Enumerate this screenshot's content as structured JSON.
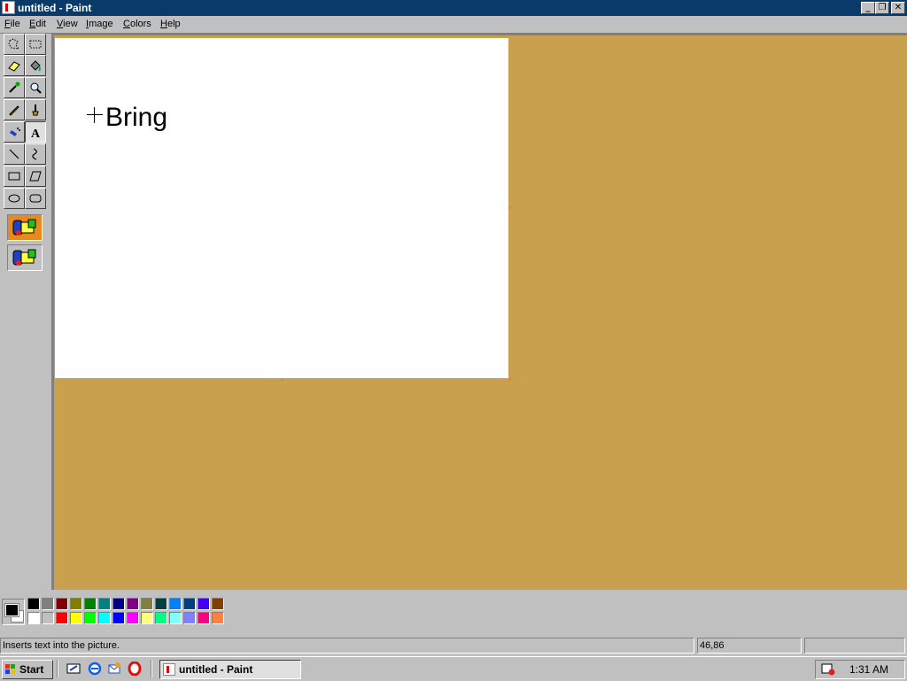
{
  "window": {
    "title": "untitled - Paint",
    "controls": {
      "minimize": "_",
      "restore": "❐",
      "close": "✕"
    }
  },
  "menu": [
    {
      "label": "File",
      "hotkey": "F",
      "rest": "ile"
    },
    {
      "label": "Edit",
      "hotkey": "E",
      "rest": "dit"
    },
    {
      "label": "View",
      "hotkey": "V",
      "rest": "iew"
    },
    {
      "label": "Image",
      "hotkey": "I",
      "rest": "mage"
    },
    {
      "label": "Colors",
      "hotkey": "C",
      "rest": "olors"
    },
    {
      "label": "Help",
      "hotkey": "H",
      "rest": "elp"
    }
  ],
  "tools": [
    {
      "name": "free-form-select",
      "icon": "free-form-select-icon"
    },
    {
      "name": "select",
      "icon": "rectangle-select-icon"
    },
    {
      "name": "eraser",
      "icon": "eraser-icon"
    },
    {
      "name": "fill",
      "icon": "fill-bucket-icon"
    },
    {
      "name": "pick-color",
      "icon": "eyedropper-icon"
    },
    {
      "name": "magnifier",
      "icon": "magnifier-icon"
    },
    {
      "name": "pencil",
      "icon": "pencil-icon"
    },
    {
      "name": "brush",
      "icon": "brush-icon"
    },
    {
      "name": "airbrush",
      "icon": "airbrush-icon"
    },
    {
      "name": "text",
      "icon": "text-icon",
      "active": true
    },
    {
      "name": "line",
      "icon": "line-icon"
    },
    {
      "name": "curve",
      "icon": "curve-icon"
    },
    {
      "name": "rectangle",
      "icon": "rectangle-icon"
    },
    {
      "name": "polygon",
      "icon": "polygon-icon"
    },
    {
      "name": "ellipse",
      "icon": "ellipse-icon"
    },
    {
      "name": "rounded-rectangle",
      "icon": "rounded-rectangle-icon"
    }
  ],
  "text_options": [
    {
      "name": "opaque-background",
      "selected": true
    },
    {
      "name": "transparent-background",
      "selected": false
    }
  ],
  "canvas": {
    "text": "Bring"
  },
  "colors": {
    "foreground": "#000000",
    "background": "#ffffff",
    "workspace": "#c9a04e",
    "palette_top": [
      "#000000",
      "#808080",
      "#800000",
      "#808000",
      "#008000",
      "#008080",
      "#000080",
      "#800080",
      "#808040",
      "#004040",
      "#0080ff",
      "#004080",
      "#4000ff",
      "#804000"
    ],
    "palette_bottom": [
      "#ffffff",
      "#c0c0c0",
      "#ff0000",
      "#ffff00",
      "#00ff00",
      "#00ffff",
      "#0000ff",
      "#ff00ff",
      "#ffff80",
      "#00ff80",
      "#80ffff",
      "#8080ff",
      "#ff0080",
      "#ff8040"
    ]
  },
  "status": {
    "message": "Inserts text into the picture.",
    "coordinates": "46,86",
    "size": ""
  },
  "taskbar": {
    "start_label": "Start",
    "quick_launch": [
      "show-desktop-icon",
      "internet-explorer-icon",
      "outlook-express-icon",
      "opera-icon"
    ],
    "task_label": "untitled - Paint",
    "clock": "1:31 AM"
  }
}
